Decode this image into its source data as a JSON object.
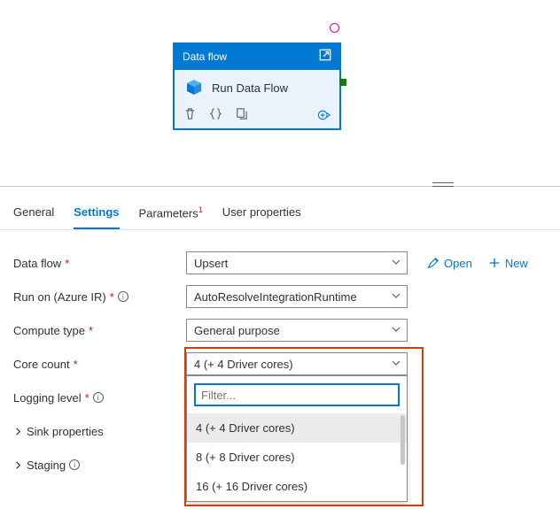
{
  "node": {
    "type_label": "Data flow",
    "activity_name": "Run Data Flow"
  },
  "tabs": {
    "general": "General",
    "settings": "Settings",
    "parameters": "Parameters",
    "user_properties": "User properties"
  },
  "labels": {
    "data_flow": "Data flow",
    "run_on": "Run on (Azure IR)",
    "compute_type": "Compute type",
    "core_count": "Core count",
    "logging_level": "Logging level",
    "sink_props": "Sink properties",
    "staging": "Staging"
  },
  "values": {
    "data_flow": "Upsert",
    "run_on": "AutoResolveIntegrationRuntime",
    "compute_type": "General purpose",
    "core_count": "4 (+ 4 Driver cores)"
  },
  "actions": {
    "open": "Open",
    "new": "New"
  },
  "dropdown": {
    "filter_placeholder": "Filter...",
    "options": {
      "o1": "4 (+ 4 Driver cores)",
      "o2": "8 (+ 8 Driver cores)",
      "o3": "16 (+ 16 Driver cores)"
    }
  }
}
